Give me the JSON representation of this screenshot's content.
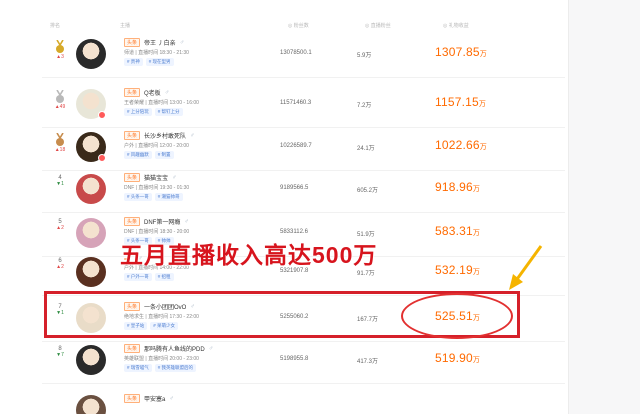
{
  "header": {
    "rank": "排名",
    "host": "主播",
    "fans": "◎ 粉丝数",
    "live_fans": "◎ 直播粉丝",
    "income": "◎ 礼物收益"
  },
  "rows": [
    {
      "rank": "",
      "delta": "▲3",
      "dir": "up",
      "medal": "gold",
      "name": "帝王 丿白亲",
      "tag": "头条",
      "sub": "师道 | 直播时间 18:30 - 21:30",
      "chips": [
        "# 贵神",
        "# 现在型男"
      ],
      "fans": "13078500.1",
      "live": "5.9万",
      "income": "1307.85",
      "unit": "万",
      "avatar": "#2a2a2a"
    },
    {
      "rank": "",
      "delta": "▲49",
      "dir": "up",
      "medal": "silver",
      "name": "Q老板",
      "tag": "头条",
      "sub": "王者荣耀 | 直播时间 13:00 - 16:00",
      "chips": [
        "# 上分陪玩",
        "# 帮钉上分"
      ],
      "fans": "11571460.3",
      "live": "7.2万",
      "income": "1157.15",
      "unit": "万",
      "avatar": "#e8e6d8"
    },
    {
      "rank": "",
      "delta": "▲18",
      "dir": "up",
      "medal": "bronze",
      "name": "长沙乡村敢死队",
      "tag": "头条",
      "sub": "户外 | 直播时间 12:00 - 20:00",
      "chips": [
        "# 风趣幽默",
        "# 制置"
      ],
      "fans": "10226589.7",
      "live": "24.1万",
      "income": "1022.66",
      "unit": "万",
      "avatar": "#3a2a1a"
    },
    {
      "rank": "4",
      "delta": "▼1",
      "dir": "down",
      "medal": "",
      "name": "猫猫宝宝",
      "tag": "头条",
      "sub": "DNF | 直播时间 19:30 - 01:30",
      "chips": [
        "# 头条一哥",
        "# 潮猫帅哥"
      ],
      "fans": "9189566.5",
      "live": "605.2万",
      "income": "918.96",
      "unit": "万",
      "avatar": "#c84a4a"
    },
    {
      "rank": "5",
      "delta": "▲2",
      "dir": "up",
      "medal": "",
      "name": "DNF第一网瘾",
      "tag": "头条",
      "sub": "DNF | 直播时间 18:30 - 20:00",
      "chips": [
        "# 头条一哥",
        "# 帅帅"
      ],
      "fans": "5833112.6",
      "live": "51.9万",
      "income": "583.31",
      "unit": "万",
      "avatar": "#d6a3b8"
    },
    {
      "rank": "6",
      "delta": "▲2",
      "dir": "up",
      "medal": "",
      "name": "",
      "tag": "",
      "sub": "户外 | 直播时间 14:00 - 22:00",
      "chips": [
        "# 户外一哥",
        "# 招租"
      ],
      "fans": "5321907.8",
      "live": "91.7万",
      "income": "532.19",
      "unit": "万",
      "avatar": "#5a3020"
    },
    {
      "rank": "7",
      "delta": "▼1",
      "dir": "down",
      "medal": "",
      "name": "一条小团团OvO",
      "tag": "头条",
      "sub": "绝地求生 | 直播时间 17:30 - 22:00",
      "chips": [
        "# 皇子站",
        "# 呆萌少女"
      ],
      "fans": "5255060.2",
      "live": "167.7万",
      "income": "525.51",
      "unit": "万",
      "avatar": "#e9dcc8"
    },
    {
      "rank": "8",
      "delta": "▼7",
      "dir": "down",
      "medal": "",
      "name": "那吗腾有人鱼线的PDD",
      "tag": "头条",
      "sub": "英雄联盟 | 直播时间 20:00 - 23:00",
      "chips": [
        "# 瑞雪喵气",
        "# 我英雄联盟后的"
      ],
      "fans": "5198955.8",
      "live": "417.3万",
      "income": "519.90",
      "unit": "万",
      "avatar": "#2a2a2a"
    },
    {
      "rank": "",
      "delta": "",
      "dir": "up",
      "medal": "",
      "name": "甲安塞a",
      "tag": "头条",
      "sub": "",
      "chips": [],
      "fans": "",
      "live": "",
      "income": "",
      "unit": "",
      "avatar": "#6a5040"
    }
  ],
  "overlay": "五月直播收入高达500万",
  "colors": {
    "accent": "#ff6a00",
    "highlight": "#d5202a",
    "arrow": "#f5b400"
  }
}
